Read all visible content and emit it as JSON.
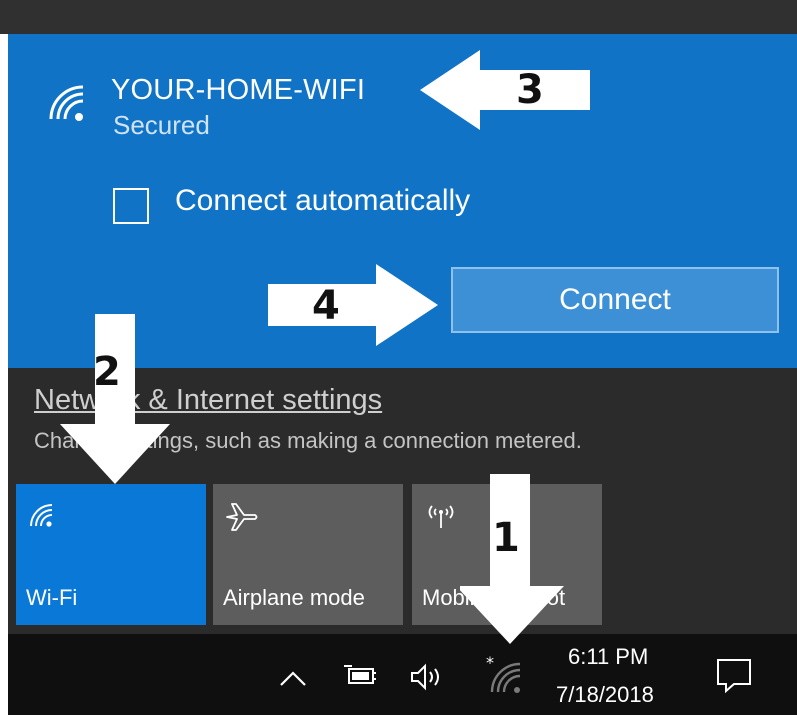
{
  "network": {
    "name": "YOUR-HOME-WIFI",
    "status": "Secured",
    "connect_automatically_label": "Connect automatically",
    "connect_automatically_checked": false,
    "connect_button": "Connect"
  },
  "settings": {
    "link_label": "Network & Internet settings",
    "description": "Change settings, such as making a connection metered."
  },
  "quick_actions": [
    {
      "label": "Wi-Fi",
      "icon": "wifi-icon",
      "active": true
    },
    {
      "label": "Airplane mode",
      "icon": "airplane-icon",
      "active": false
    },
    {
      "label": "Mobile hotspot",
      "icon": "hotspot-icon",
      "active": false
    }
  ],
  "taskbar": {
    "time": "6:11 PM",
    "date": "7/18/2018",
    "icons": [
      "chevron-up-icon",
      "battery-icon",
      "volume-icon",
      "wifi-icon",
      "action-center-icon"
    ]
  },
  "annotations": [
    {
      "number": "1",
      "target": "taskbar wifi icon"
    },
    {
      "number": "2",
      "target": "Wi-Fi tile"
    },
    {
      "number": "3",
      "target": "network name"
    },
    {
      "number": "4",
      "target": "Connect button"
    }
  ],
  "colors": {
    "card_blue": "#1073c6",
    "tile_active": "#0a78d7",
    "tile_inactive": "#5d5d5d",
    "panel_dark": "#2b2b2b",
    "taskbar": "#0f0f0f"
  }
}
